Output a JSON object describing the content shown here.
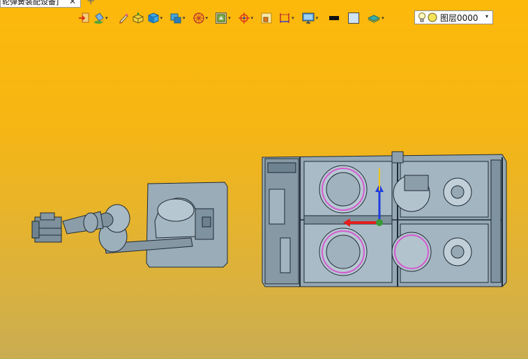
{
  "tab": {
    "title": "轮弹簧装配设备]",
    "close_glyph": "✕",
    "add_glyph": "+"
  },
  "toolbar": {
    "dropdown_glyph": "▾",
    "items": [
      {
        "icon": "import-icon"
      },
      {
        "icon": "paint-bucket-icon",
        "dropdown": true
      },
      {
        "icon": "sketch-pen-icon"
      },
      {
        "icon": "extrude-box-icon"
      },
      {
        "icon": "solid-cube-icon",
        "dropdown": true
      },
      {
        "icon": "assembly-cube-icon",
        "dropdown": true
      },
      {
        "icon": "wireframe-view-icon",
        "dropdown": true
      },
      {
        "icon": "view-frame-icon",
        "dropdown": true
      },
      {
        "icon": "snap-target-icon",
        "dropdown": true
      },
      {
        "icon": "section-view-icon"
      },
      {
        "icon": "measure-icon",
        "dropdown": true
      },
      {
        "icon": "display-monitor-icon",
        "dropdown": true
      },
      {
        "icon": "black-color-swatch-icon"
      },
      {
        "icon": "white-color-swatch-icon"
      },
      {
        "icon": "surface-layer-icon",
        "dropdown": true
      }
    ]
  },
  "layer": {
    "value": "图层0000",
    "bulb_icon": "light-bulb-icon",
    "color_icon": "layer-color-dot-icon",
    "caret": "▾"
  },
  "colors": {
    "background_top": "#FDB90A",
    "background_bottom": "#C9AD52",
    "model_fill": "#8FA2AE",
    "model_edge": "#1E2A34",
    "triad_x": "#E31E1E",
    "triad_y": "#F0C419",
    "triad_z": "#1E3CE0",
    "spring_ring": "#D45AD0"
  }
}
